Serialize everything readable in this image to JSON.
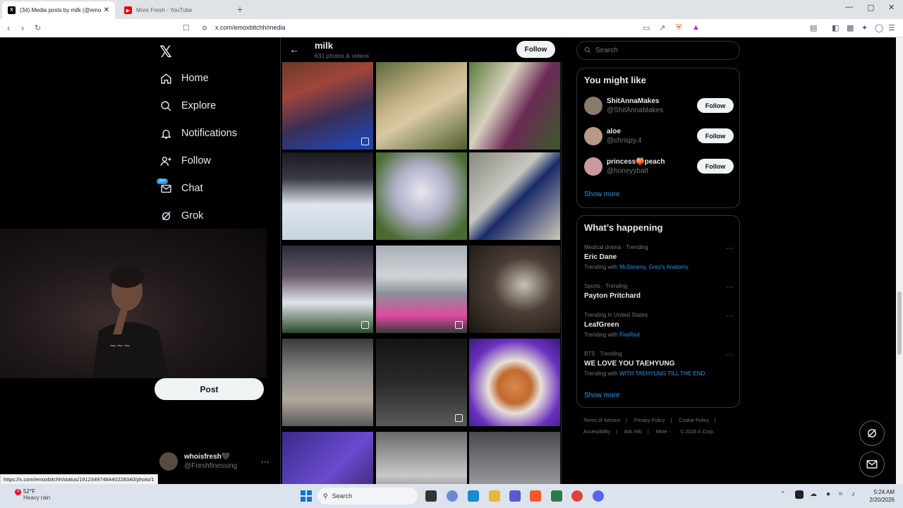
{
  "browser": {
    "tabs": [
      {
        "title": "(34) Media posts by milk (@emo",
        "close": "✕"
      },
      {
        "title": "More Fresh - YouTube"
      }
    ],
    "new_tab": "+",
    "url": "x.com/emoxbitchh/media",
    "window_controls": [
      "—",
      "▢",
      "✕"
    ],
    "status_url": "https://x.com/emoxbitchh/status/1912349748440228340/photo/1"
  },
  "nav": {
    "logo": "𝕏",
    "items": [
      {
        "label": "Home",
        "icon": "home-icon"
      },
      {
        "label": "Explore",
        "icon": "search-icon"
      },
      {
        "label": "Notifications",
        "icon": "bell-icon"
      },
      {
        "label": "Follow",
        "icon": "person-add-icon"
      },
      {
        "label": "Chat",
        "icon": "mail-icon",
        "badge": "20+"
      },
      {
        "label": "Grok",
        "icon": "grok-icon"
      }
    ],
    "post_label": "Post",
    "account": {
      "name": "whoisfresh🖤",
      "handle": "@Freshfinessing",
      "more": "···"
    }
  },
  "profile": {
    "name": "milk",
    "count": "631 photos & videos",
    "follow_label": "Follow",
    "back": "←"
  },
  "media": [
    {
      "multi": true
    },
    {
      "multi": false
    },
    {
      "multi": false
    },
    {
      "multi": false
    },
    {
      "multi": false
    },
    {
      "multi": false
    },
    {
      "multi": true
    },
    {
      "multi": true
    },
    {
      "multi": false
    },
    {
      "multi": false
    },
    {
      "multi": true
    },
    {
      "multi": false
    },
    {
      "multi": false
    },
    {
      "multi": false
    },
    {
      "multi": false
    }
  ],
  "search": {
    "placeholder": "Search"
  },
  "you_might_like": {
    "title": "You might like",
    "users": [
      {
        "name": "ShitAnnaMakes",
        "handle": "@ShitAnnaMakes",
        "follow": "Follow"
      },
      {
        "name": "aloe",
        "handle": "@chrispy.4",
        "follow": "Follow"
      },
      {
        "name": "princess🍑peach",
        "handle": "@honeyybatt",
        "follow": "Follow"
      }
    ],
    "show_more": "Show more"
  },
  "happening": {
    "title": "What’s happening",
    "trends": [
      {
        "context": "Medical drama · Trending",
        "title": "Eric Dane",
        "with_prefix": "Trending with ",
        "with_links": "McSteamy, Grey's Anatomy"
      },
      {
        "context": "Sports · Trending",
        "title": "Payton Pritchard",
        "with_prefix": "",
        "with_links": ""
      },
      {
        "context": "Trending in United States",
        "title": "LeafGreen",
        "with_prefix": "Trending with ",
        "with_links": "FireRed"
      },
      {
        "context": "BTS · Trending",
        "title": "WE LOVE YOU TAEHYUNG",
        "with_prefix": "Trending with ",
        "with_links": "WITH TAEHYUNG TILL THE END"
      }
    ],
    "more": "···",
    "show_more": "Show more"
  },
  "footer": {
    "line1": [
      "Terms of Service",
      "|",
      "Privacy Policy",
      "|",
      "Cookie Policy",
      "|"
    ],
    "line2": [
      "Accessibility",
      "|",
      "Ads info",
      "|",
      "More ···",
      "© 2026 X Corp."
    ]
  },
  "taskbar": {
    "weather_badge": "4",
    "temp": "52°F",
    "condition": "Heavy rain",
    "search_label": "Search",
    "time": "5:24 AM",
    "date": "2/20/2026"
  },
  "colors": {
    "accent": "#1d9bf0",
    "background": "#000000",
    "border": "#2f3336",
    "muted": "#71767b"
  }
}
